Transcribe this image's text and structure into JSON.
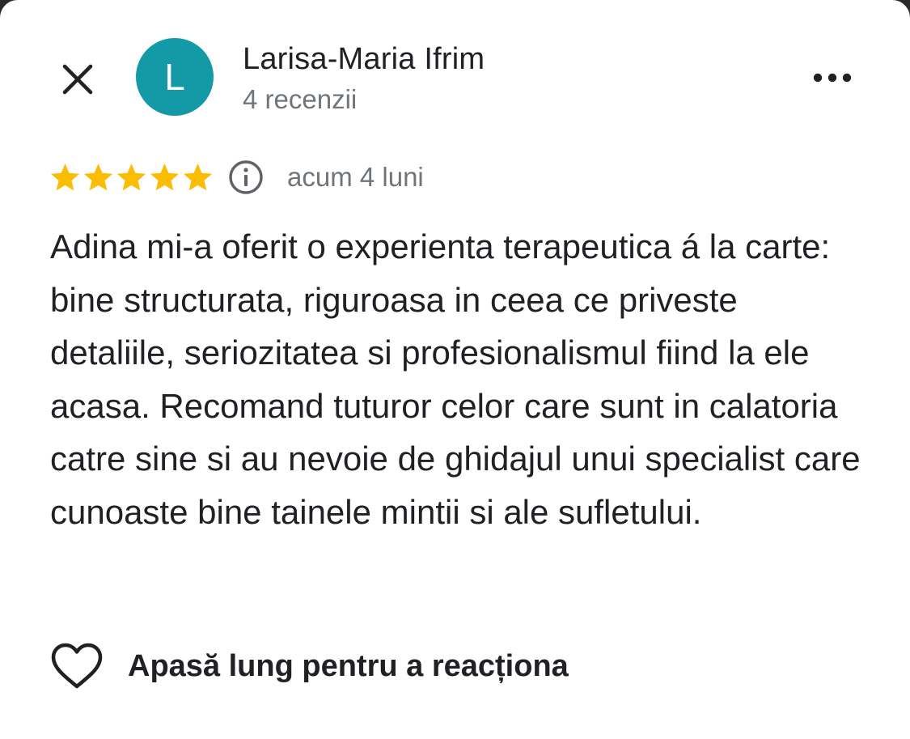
{
  "header": {
    "close_icon": "close-icon",
    "avatar_letter": "L",
    "avatar_color": "#1499a6",
    "author_name": "Larisa-Maria Ifrim",
    "review_count": "4 recenzii",
    "more_icon": "more-horizontal-icon"
  },
  "review": {
    "rating": 5,
    "rating_max": 5,
    "star_color": "#fbbc04",
    "info_icon": "info-icon",
    "time_ago": "acum 4 luni",
    "text": "Adina mi-a oferit o experienta terapeutica á la carte: bine structurata, riguroasa in ceea ce priveste detaliile, seriozitatea si profesionalismul fiind la ele acasa. Recomand tuturor celor care sunt in calatoria catre sine si au nevoie de ghidajul unui specialist care cunoaste bine tainele mintii si ale sufletului."
  },
  "reaction": {
    "icon": "heart-icon",
    "label": "Apasă lung pentru a reacționa"
  }
}
